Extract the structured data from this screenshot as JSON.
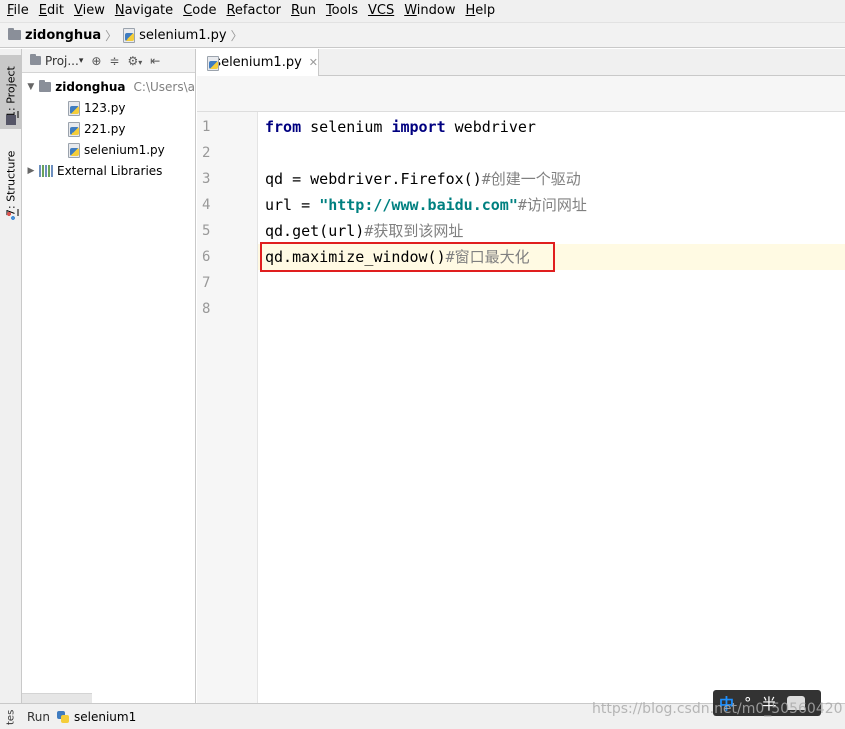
{
  "menubar": {
    "items": [
      {
        "mnemonic": "F",
        "rest": "ile"
      },
      {
        "mnemonic": "E",
        "rest": "dit"
      },
      {
        "mnemonic": "V",
        "rest": "iew"
      },
      {
        "mnemonic": "N",
        "rest": "avigate"
      },
      {
        "mnemonic": "C",
        "rest": "ode"
      },
      {
        "mnemonic": "R",
        "rest": "efactor"
      },
      {
        "mnemonic": "R",
        "rest": "un"
      },
      {
        "mnemonic": "T",
        "rest": "ools"
      },
      {
        "mnemonic": "VCS",
        "rest": ""
      },
      {
        "mnemonic": "W",
        "rest": "indow"
      },
      {
        "mnemonic": "H",
        "rest": "elp"
      }
    ]
  },
  "breadcrumb": {
    "project": "zidonghua",
    "file": "selenium1.py"
  },
  "left_stripe": {
    "project_num": "1",
    "project_label": ": Project",
    "structure_num": "7",
    "structure_label": ": Structure",
    "bottom_label": "tes"
  },
  "project_panel": {
    "view_label": "Proj...",
    "root": {
      "name": "zidonghua",
      "path": "C:\\Users\\a"
    },
    "files": [
      "123.py",
      "221.py",
      "selenium1.py"
    ],
    "external": "External Libraries"
  },
  "editor": {
    "tab_label": "selenium1.py",
    "line_numbers": [
      "1",
      "2",
      "3",
      "4",
      "5",
      "6",
      "7",
      "8"
    ],
    "lines": {
      "l1_kw1": "from",
      "l1_mid": " selenium ",
      "l1_kw2": "import",
      "l1_end": " webdriver",
      "l3_code": "qd = webdriver.Firefox()",
      "l3_cmt": "#创建一个驱动",
      "l4_code": "url = ",
      "l4_str": "\"http://www.baidu.com\"",
      "l4_cmt": "#访问网址",
      "l5_code": "qd.get(url)",
      "l5_cmt": "#获取到该网址",
      "l6_code": "qd.maximize_window()",
      "l6_cmt": "#窗口最大化"
    },
    "current_line": 6
  },
  "bottom_bar": {
    "run_label": "Run",
    "run_file": "selenium1"
  },
  "overlay": {
    "watermark": "https://blog.csdn.net/m0_50560420",
    "ime_cn": "中",
    "ime_dot": "°",
    "ime_half": "半"
  },
  "colors": {
    "keyword": "#000080",
    "string": "#008080",
    "comment": "#808080",
    "current_line_bg": "#fffae3",
    "highlight_box": "#e01e1e"
  }
}
